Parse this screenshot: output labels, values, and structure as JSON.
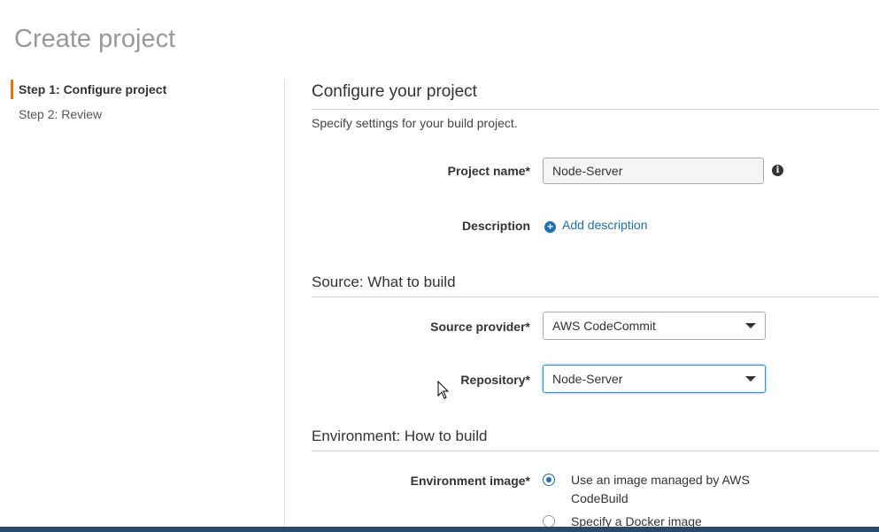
{
  "page": {
    "title": "Create project"
  },
  "sidebar": {
    "steps": [
      {
        "label": "Step 1: Configure project"
      },
      {
        "label": "Step 2: Review"
      }
    ]
  },
  "configure": {
    "title": "Configure your project",
    "subtitle": "Specify settings for your build project.",
    "project_name_label": "Project name*",
    "project_name_value": "Node-Server",
    "description_label": "Description",
    "add_description_label": "Add description"
  },
  "source": {
    "title": "Source: What to build",
    "provider_label": "Source provider*",
    "provider_value": "AWS CodeCommit",
    "repository_label": "Repository*",
    "repository_value": "Node-Server"
  },
  "environment": {
    "title": "Environment: How to build",
    "image_label": "Environment image*",
    "options": [
      {
        "label": "Use an image managed by AWS CodeBuild",
        "selected": true
      },
      {
        "label": "Specify a Docker image",
        "selected": false
      }
    ]
  },
  "icons": {
    "info": "info-icon",
    "add": "plus-circle-icon",
    "caret": "chevron-down-icon",
    "cursor": "mouse-pointer-icon"
  },
  "colors": {
    "accent": "#e07b00",
    "link": "#1f6fb5",
    "focus": "#2f8fdf",
    "bottom_bar": "#2c4a6b"
  }
}
